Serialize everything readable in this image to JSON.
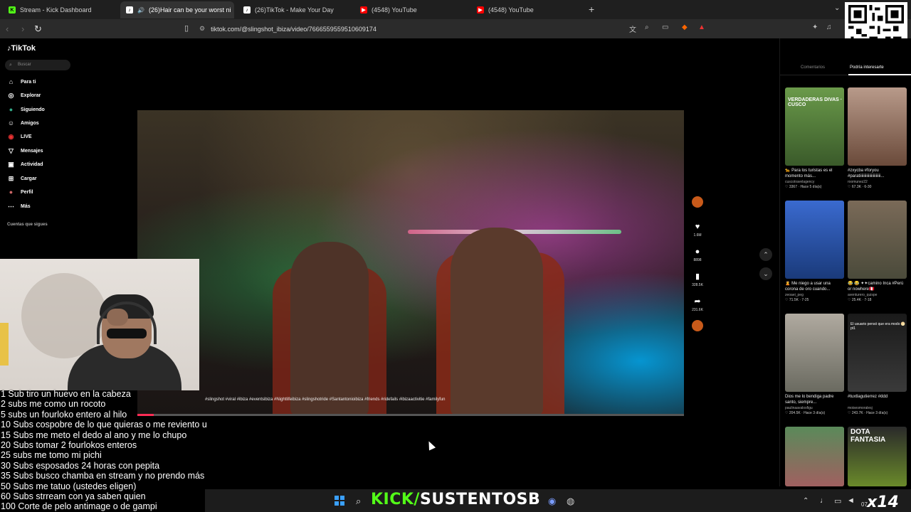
{
  "browser": {
    "tabs": [
      {
        "title": "Stream - Kick Dashboard",
        "favicon_color": "#53fc18",
        "favicon_char": "K"
      },
      {
        "title": "(26)Hair can be your worst ni",
        "favicon_color": "#ffffff",
        "favicon_char": "♪",
        "active": true
      },
      {
        "title": "(26)TikTok - Make Your Day",
        "favicon_color": "#ffffff",
        "favicon_char": "♪"
      },
      {
        "title": "(4548) YouTube",
        "favicon_color": "#ff0000",
        "favicon_char": "▶"
      },
      {
        "title": "(4548) YouTube",
        "favicon_color": "#ff0000",
        "favicon_char": "▶"
      }
    ],
    "new_tab": "+",
    "url": "tiktok.com/@slingshot_ibiza/video/7666559559510609174"
  },
  "tiktok": {
    "logo": "TikTok",
    "search_placeholder": "Buscar",
    "nav": [
      {
        "label": "Para ti",
        "icon": "⌂"
      },
      {
        "label": "Explorar",
        "icon": "◎"
      },
      {
        "label": "Siguiendo",
        "icon": "●"
      },
      {
        "label": "Amigos",
        "icon": "☺"
      },
      {
        "label": "LIVE",
        "icon": "◉"
      },
      {
        "label": "Mensajes",
        "icon": "▽"
      },
      {
        "label": "Actividad",
        "icon": "▣"
      },
      {
        "label": "Cargar",
        "icon": "⊞"
      },
      {
        "label": "Perfil",
        "icon": "●"
      },
      {
        "label": "Más",
        "icon": "⋯"
      }
    ],
    "following_heading": "Cuentas que sigues",
    "video_caption": "#slingshot #viral #ibiza #eventsibiza #Nightlifeibiza #slingshotride #Santantonioibiza #friends #ridefails #ibizaactivitie #familyfun",
    "actions": {
      "likes": "1.6M",
      "comments": "8898",
      "saves": "328.5K",
      "shares": "231.6K"
    },
    "progress": 0.03
  },
  "right_panel": {
    "tabs": [
      "Comentarios",
      "Podría interesarte"
    ],
    "cards": [
      {
        "text": "🐆 Para los turistas es el momento más...",
        "author": "cuscotravelagency",
        "stats": "♡ 3367 · Hace 5 día(s)",
        "overlay": "VERDADERAS DIVAS · CUSCO",
        "bg": "#4d7a3a"
      },
      {
        "text": "#zxycba #foryou #paratiiiiiiiiiiiiiiiiiiiiii...",
        "author": "roomunez22",
        "stats": "♡ 67.3K · 6-30",
        "overlay": "",
        "bg": "#8a6a5a"
      },
      {
        "text": "🙎 Me niego a usar una corona de oro cuando...",
        "author": "zeoaei_peg",
        "stats": "♡ 71.5K · 7-25",
        "overlay": "",
        "bg": "#1d4a9a"
      },
      {
        "text": "😂 😂 ✦✦camino Inca #Perú or nowhere🇵🇪",
        "author": "aventurero_quispe",
        "stats": "♡ 25.4K · 7-18",
        "overlay": "",
        "bg": "#6b5a48"
      },
      {
        "text": "Dios me lo bendiga padre santo, siempre...",
        "author": "paulinaavalosfigu",
        "stats": "♡ 204.5K · Hace 3 día(s)",
        "overlay": "",
        "bg": "#8a8a80"
      },
      {
        "text": "#tuxtlagutierrez #ddd",
        "author": "moisesmoralesj",
        "stats": "♡ 243.7K · Hace 3 día(s)",
        "overlay": "El usuario pensó que era modo 🌕 pt1",
        "bg": "#1a1a1a"
      },
      {
        "text": "",
        "author": "",
        "stats": "",
        "overlay": "",
        "bg": "#3a5a3a"
      },
      {
        "text": "",
        "author": "",
        "stats": "",
        "overlay": "DOTA FANTASIA",
        "bg": "#2a3a1a"
      }
    ]
  },
  "overlay": {
    "subs": [
      "1 Sub tiro un huevo en la cabeza",
      "2 subs me como un rocoto",
      "5 subs un fourloko entero al hilo",
      "10 Subs cospobre de lo que quieras o me reviento u",
      "15 Subs me meto el dedo al ano y me lo chupo",
      "20 Subs tomar 2 fourlokos enteros",
      "25 subs me tomo mi pichi",
      "30 Subs esposados 24 horas con pepita",
      "35 Subs busco chamba en stream y no prendo más",
      "50 Subs me tatuo (ustedes eligen)",
      "60 Subs strream con ya saben quien",
      "100 Corte de pelo antimage o de gampi"
    ],
    "banner_kick": "KICK/",
    "banner_name": "SUSTENTOSB",
    "multiplier": "x14"
  },
  "taskbar": {
    "clock": "07"
  }
}
